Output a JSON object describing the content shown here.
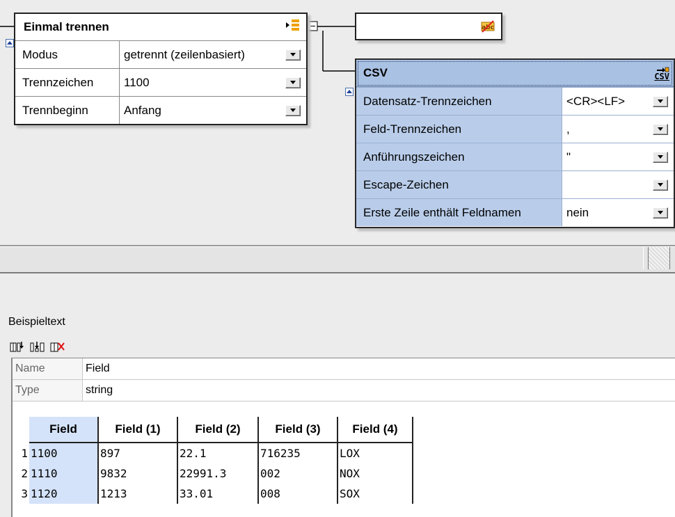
{
  "split_node": {
    "title": "Einmal trennen",
    "rows": [
      {
        "label": "Modus",
        "value": "getrennt (zeilenbasiert)"
      },
      {
        "label": "Trennzeichen",
        "value": "1100"
      },
      {
        "label": "Trennbeginn",
        "value": "Anfang"
      }
    ]
  },
  "csv_node": {
    "title": "CSV",
    "icon_text": "CSV",
    "rows": [
      {
        "label": "Datensatz-Trennzeichen",
        "value": "<CR><LF>"
      },
      {
        "label": "Feld-Trennzeichen",
        "value": ","
      },
      {
        "label": "Anführungszeichen",
        "value": "\""
      },
      {
        "label": "Escape-Zeichen",
        "value": ""
      },
      {
        "label": "Erste Zeile enthält Feldnamen",
        "value": "nein"
      }
    ]
  },
  "sample": {
    "label": "Beispieltext",
    "meta": [
      {
        "key": "Name",
        "value": "Field"
      },
      {
        "key": "Type",
        "value": "string"
      }
    ],
    "headers": [
      "Field",
      "Field (1)",
      "Field (2)",
      "Field (3)",
      "Field (4)"
    ],
    "rows": [
      {
        "num": "1",
        "cells": [
          "1100",
          "897",
          "22.1",
          "716235",
          "LOX"
        ]
      },
      {
        "num": "2",
        "cells": [
          "1110",
          "9832",
          "22991.3",
          "002",
          "NOX"
        ]
      },
      {
        "num": "3",
        "cells": [
          "1120",
          "1213",
          "33.01",
          "008",
          "SOX"
        ]
      }
    ]
  },
  "colors": {
    "csv_header": "#a9c1e3",
    "csv_label_bg": "#b9cdea",
    "first_col": "#d4e3fa",
    "icon_orange": "#f0a000"
  },
  "icons": [
    "split-icon",
    "no-text-icon",
    "csv-format-icon",
    "add-column-icon",
    "insert-column-icon",
    "delete-column-icon"
  ]
}
